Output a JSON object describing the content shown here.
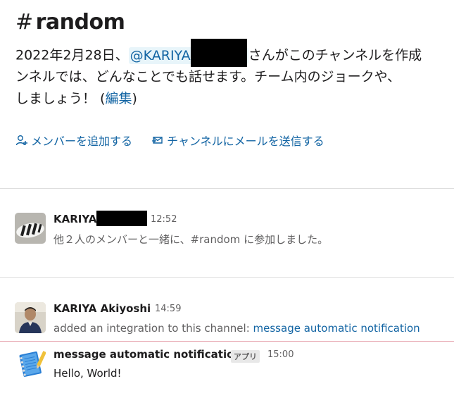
{
  "channel": {
    "hash": "#",
    "name": "random"
  },
  "intro": {
    "line1_prefix": "2022年2月28日、",
    "mention": "@KARIYA",
    "line1_suffix": "さんがこのチャンネルを作成",
    "line2": "ンネルでは、どんなことでも話せます。チーム内のジョークや、",
    "line3_prefix": "しましょう！ (",
    "edit_link": "編集",
    "line3_suffix": ")"
  },
  "actions": {
    "add_member": "メンバーを追加する",
    "send_email": "チャンネルにメールを送信する"
  },
  "messages": [
    {
      "author": "KARIYA",
      "time": "12:52",
      "text": "他２人のメンバーと一緒に、#random に参加しました。"
    },
    {
      "author": "KARIYA Akiyoshi",
      "time": "14:59",
      "text_prefix": "added an integration to this channel: ",
      "link": "message automatic notification"
    },
    {
      "author": "message automatic notification",
      "badge": "アプリ",
      "time": "15:00",
      "text": "Hello, World!"
    }
  ],
  "colors": {
    "link": "#1264a3",
    "mention_bg": "#e8f5fa",
    "new_divider": "#e8a9b3"
  }
}
